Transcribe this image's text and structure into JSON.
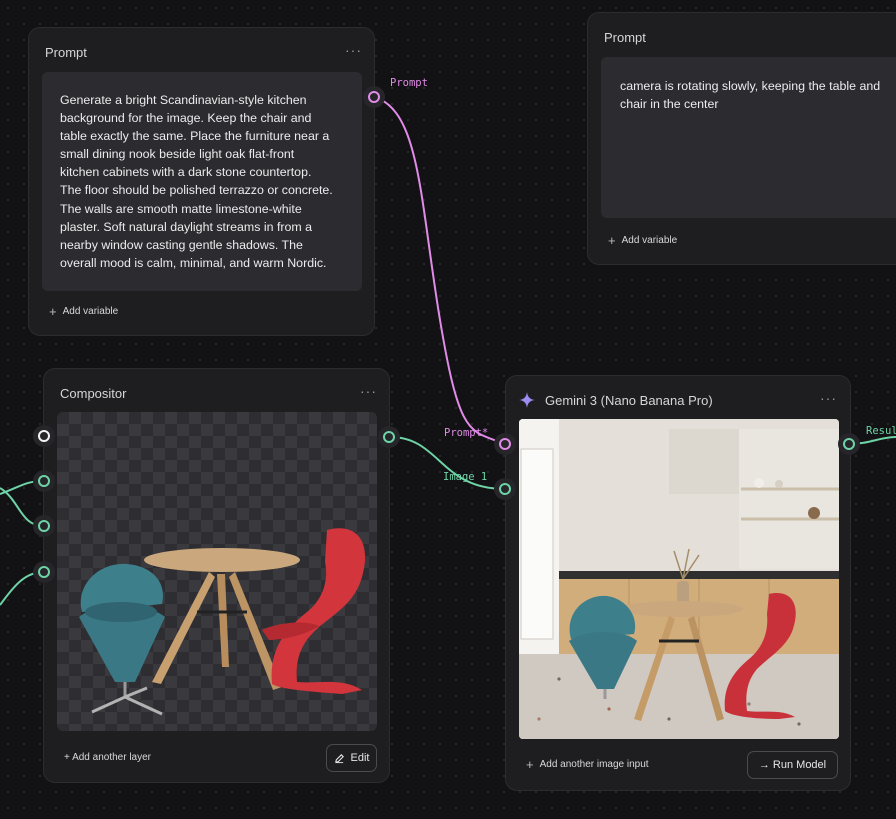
{
  "prompt_node_1": {
    "title": "Prompt",
    "text": "Generate a bright Scandinavian-style kitchen\nbackground for the image. Keep the chair and\ntable exactly the same. Place the furniture near a\nsmall dining nook beside light oak flat-front\nkitchen cabinets with a dark stone countertop.\nThe floor should be polished terrazzo or concrete.\nThe walls are smooth matte limestone-white\nplaster. Soft natural daylight streams in from a\nnearby window casting gentle shadows. The\noverall mood is calm, minimal, and warm Nordic.",
    "add_variable": "Add variable",
    "output_label": "Prompt"
  },
  "prompt_node_2": {
    "title": "Prompt",
    "text": "camera is rotating slowly, keeping the table and\nchair in the center",
    "add_variable": "Add variable"
  },
  "compositor_node": {
    "title": "Compositor",
    "add_layer": "+ Add another layer",
    "edit_button": "Edit"
  },
  "gemini_node": {
    "title": "Gemini 3 (Nano Banana Pro)",
    "input_prompt_label": "Prompt*",
    "input_image_label": "Image 1",
    "output_label": "Resul",
    "add_image_input": "Add another image input",
    "run_button": "→ Run Model"
  },
  "menu_glyph": "···",
  "colors": {
    "prompt_edge": "#e08be6",
    "image_edge": "#6ed3a6",
    "canvas_bg": "#121214",
    "node_bg": "#1e1e21"
  }
}
